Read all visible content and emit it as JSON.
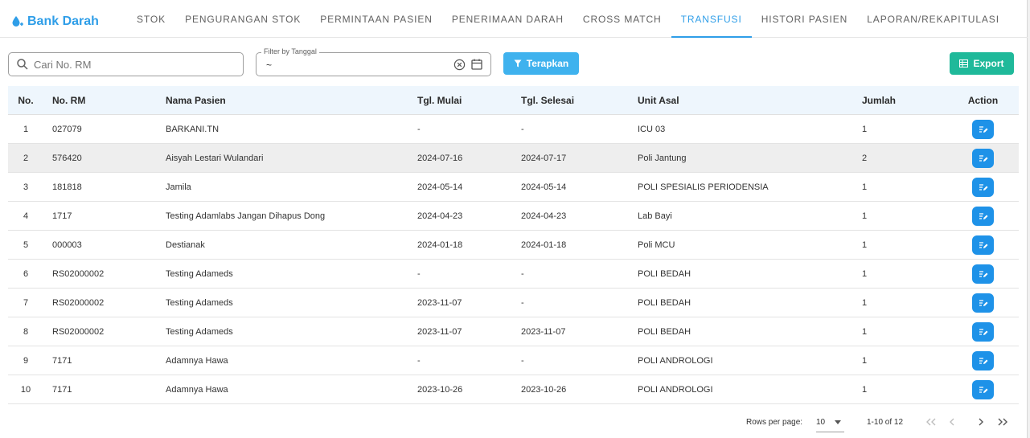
{
  "app": {
    "title": "Bank Darah"
  },
  "nav": {
    "tabs": [
      {
        "label": "STOK"
      },
      {
        "label": "PENGURANGAN STOK"
      },
      {
        "label": "PERMINTAAN PASIEN"
      },
      {
        "label": "PENERIMAAN DARAH"
      },
      {
        "label": "CROSS MATCH"
      },
      {
        "label": "TRANSFUSI"
      },
      {
        "label": "HISTORI PASIEN"
      },
      {
        "label": "LAPORAN/REKAPITULASI"
      }
    ],
    "active": "TRANSFUSI"
  },
  "filters": {
    "search": {
      "placeholder": "Cari No. RM",
      "value": ""
    },
    "date": {
      "label": "Filter by Tanggal",
      "value": "~"
    },
    "apply_label": "Terapkan",
    "export_label": "Export"
  },
  "table": {
    "headers": {
      "no": "No.",
      "rm": "No. RM",
      "nama": "Nama Pasien",
      "mulai": "Tgl. Mulai",
      "selesai": "Tgl. Selesai",
      "unit": "Unit Asal",
      "jumlah": "Jumlah",
      "action": "Action"
    },
    "rows": [
      {
        "no": "1",
        "rm": "027079",
        "nama": "BARKANI.TN",
        "mulai": "-",
        "selesai": "-",
        "unit": "ICU 03",
        "jumlah": "1"
      },
      {
        "no": "2",
        "rm": "576420",
        "nama": "Aisyah Lestari Wulandari",
        "mulai": "2024-07-16",
        "selesai": "2024-07-17",
        "unit": "Poli Jantung",
        "jumlah": "2"
      },
      {
        "no": "3",
        "rm": "181818",
        "nama": "Jamila",
        "mulai": "2024-05-14",
        "selesai": "2024-05-14",
        "unit": "POLI SPESIALIS PERIODENSIA",
        "jumlah": "1"
      },
      {
        "no": "4",
        "rm": "1717",
        "nama": "Testing Adamlabs Jangan Dihapus Dong",
        "mulai": "2024-04-23",
        "selesai": "2024-04-23",
        "unit": "Lab Bayi",
        "jumlah": "1"
      },
      {
        "no": "5",
        "rm": "000003",
        "nama": "Destianak",
        "mulai": "2024-01-18",
        "selesai": "2024-01-18",
        "unit": "Poli MCU",
        "jumlah": "1"
      },
      {
        "no": "6",
        "rm": "RS02000002",
        "nama": "Testing Adameds",
        "mulai": "-",
        "selesai": "-",
        "unit": "POLI BEDAH",
        "jumlah": "1"
      },
      {
        "no": "7",
        "rm": "RS02000002",
        "nama": "Testing Adameds",
        "mulai": "2023-11-07",
        "selesai": "-",
        "unit": "POLI BEDAH",
        "jumlah": "1"
      },
      {
        "no": "8",
        "rm": "RS02000002",
        "nama": "Testing Adameds",
        "mulai": "2023-11-07",
        "selesai": "2023-11-07",
        "unit": "POLI BEDAH",
        "jumlah": "1"
      },
      {
        "no": "9",
        "rm": "7171",
        "nama": "Adamnya Hawa",
        "mulai": "-",
        "selesai": "-",
        "unit": "POLI ANDROLOGI",
        "jumlah": "1"
      },
      {
        "no": "10",
        "rm": "7171",
        "nama": "Adamnya Hawa",
        "mulai": "2023-10-26",
        "selesai": "2023-10-26",
        "unit": "POLI ANDROLOGI",
        "jumlah": "1"
      }
    ],
    "highlighted_row": 2
  },
  "pagination": {
    "rows_per_page_label": "Rows per page:",
    "rows_per_page": "10",
    "range": "1-10 of 12"
  },
  "colors": {
    "accent": "#2f9ee8",
    "apply": "#3fb2ee",
    "export": "#1fb99a",
    "edit": "#1e92e8"
  }
}
